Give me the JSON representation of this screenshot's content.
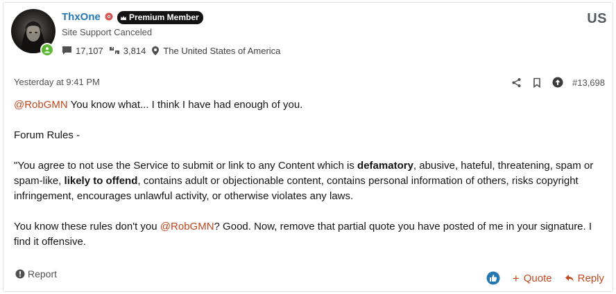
{
  "author": {
    "username": "ThxOne",
    "badge": "Premium Member",
    "title": "Site Support Canceled",
    "messages": "17,107",
    "reactions": "3,814",
    "location": "The United States of America",
    "flag": "US",
    "online": true
  },
  "post": {
    "date": "Yesterday at 9:41 PM",
    "number": "#13,698"
  },
  "message": {
    "p1_mention": "@RobGMN",
    "p1_text": " You know what... I think I have had enough of you.",
    "p2_text": "Forum Rules -",
    "p3_a": "\"You agree to not use the Service to submit or link to any Content which is ",
    "p3_b": "defamatory",
    "p3_c": ", abusive, hateful, threatening, spam or spam-like, ",
    "p3_d": "likely to offend",
    "p3_e": ", contains adult or objectionable content, contains personal information of others, risks copyright infringement, encourages unlawful activity, or otherwise violates any laws.",
    "p4_a": "You know these rules don't you ",
    "p4_mention": "@RobGMN",
    "p4_b": "? Good. Now, remove that partial quote you have posted of me in your signature. I find it offensive."
  },
  "footer": {
    "report": "Report",
    "quote": "Quote",
    "reply": "Reply"
  },
  "colors": {
    "username": "#2577b1",
    "accent": "#c0471e",
    "online": "#5fb832",
    "like": "#2577b1"
  },
  "icons": [
    "staff-icon",
    "crown-icon",
    "messages-icon",
    "reactions-icon",
    "location-icon",
    "share-icon",
    "bookmark-icon",
    "up-arrow-icon",
    "report-icon",
    "like-icon",
    "reply-arrow-icon"
  ]
}
